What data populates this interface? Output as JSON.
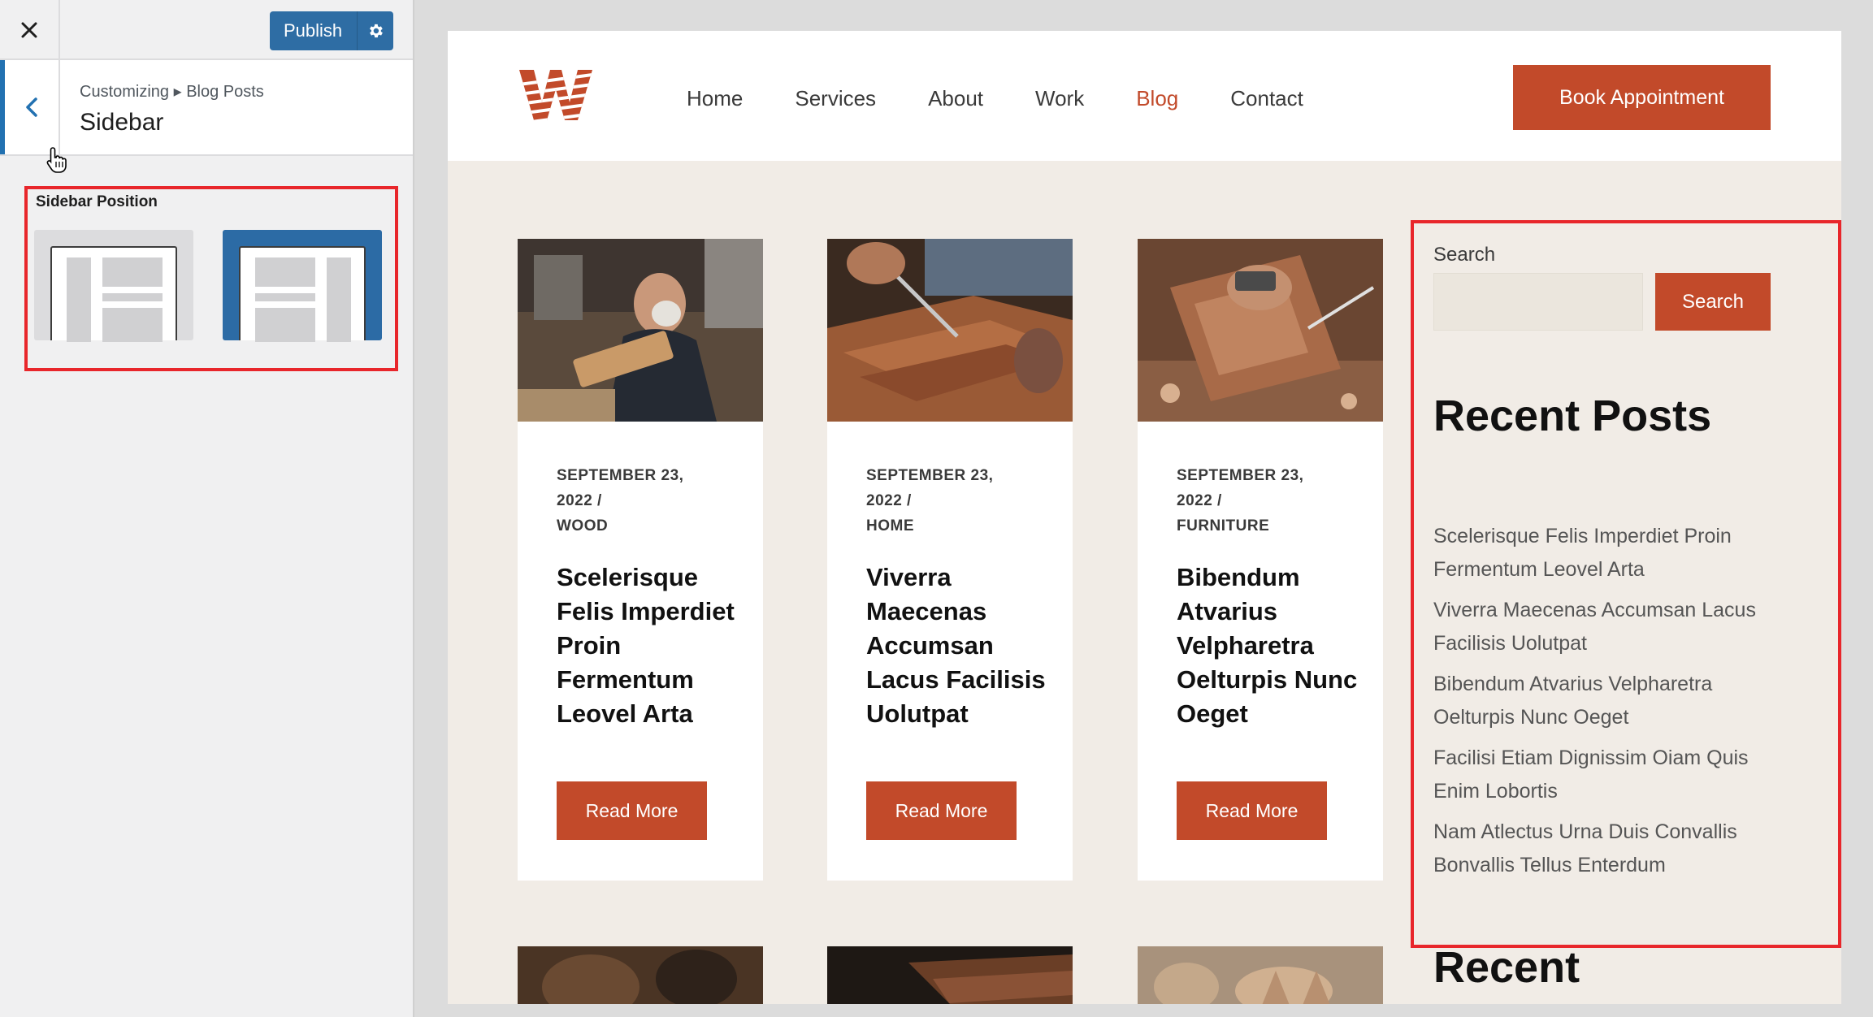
{
  "customizer": {
    "publish_label": "Publish",
    "breadcrumb": "Customizing ▸ Blog Posts",
    "section_title": "Sidebar",
    "control_label": "Sidebar Position",
    "selected_option": "right-sidebar"
  },
  "site": {
    "nav": [
      "Home",
      "Services",
      "About",
      "Work",
      "Blog",
      "Contact"
    ],
    "active_nav": "Blog",
    "cta_label": "Book Appointment",
    "brand_color": "#c24a2a",
    "posts": [
      {
        "date_line1": "SEPTEMBER 23,",
        "date_line2": "2022  /",
        "category": "WOOD",
        "title": "Scelerisque Felis Imperdiet Proin Fermentum Leovel Arta",
        "button": "Read More"
      },
      {
        "date_line1": "SEPTEMBER 23,",
        "date_line2": "2022  /",
        "category": "HOME",
        "title": "Viverra Maecenas Accumsan Lacus Facilisis Uolutpat",
        "button": "Read More"
      },
      {
        "date_line1": "SEPTEMBER 23,",
        "date_line2": "2022  /",
        "category": "FURNITURE",
        "title": "Bibendum Atvarius Velpharetra Oelturpis Nunc Oeget",
        "button": "Read More"
      }
    ],
    "sidebar": {
      "search_label": "Search",
      "search_button": "Search",
      "recent_heading": "Recent Posts",
      "recent_posts": [
        "Scelerisque Felis Imperdiet Proin Fermentum Leovel Arta",
        "Viverra Maecenas Accumsan Lacus Facilisis Uolutpat",
        "Bibendum Atvarius Velpharetra Oelturpis Nunc Oeget",
        "Facilisi Etiam Dignissim Oiam Quis Enim Lobortis",
        "Nam Atlectus Urna Duis Convallis Bonvallis Tellus Enterdum"
      ],
      "next_heading": "Recent"
    }
  }
}
